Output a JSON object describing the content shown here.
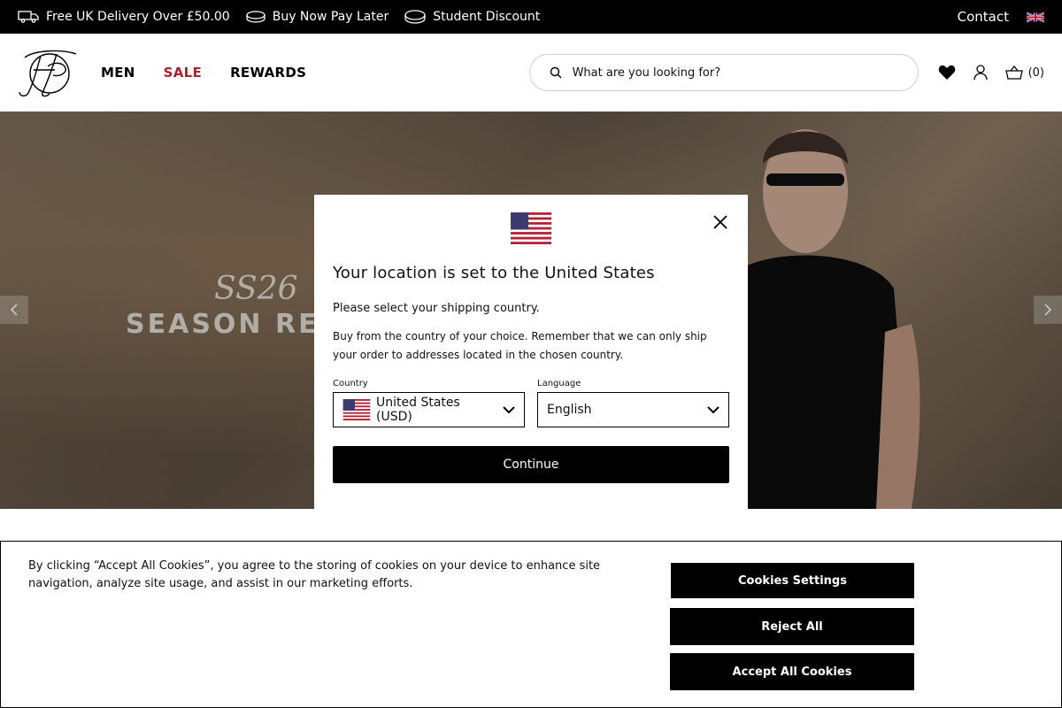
{
  "promo": {
    "items": [
      "Free UK Delivery Over £50.00",
      "Buy Now Pay Later",
      "Student Discount"
    ],
    "contact": "Contact"
  },
  "header": {
    "nav": [
      "MEN",
      "SALE",
      "REWARDS"
    ],
    "search_placeholder": "What are you looking for?",
    "basket_count": "(0)"
  },
  "hero": {
    "subtitle": "SS26",
    "title": "SEASON REF"
  },
  "modal": {
    "title": "Your location is set to the United States",
    "subtitle": "Please select your shipping country.",
    "body": "Buy from the country of your choice. Remember that we can only ship your order to addresses located in the chosen country.",
    "country_label": "Country",
    "country_value": "United States (USD)",
    "language_label": "Language",
    "language_value": "English",
    "continue_label": "Continue"
  },
  "cookie": {
    "text": "By clicking “Accept All Cookies”, you agree to the storing of cookies on your device to enhance site navigation, analyze site usage, and assist in our marketing efforts.",
    "settings_label": "Cookies Settings",
    "reject_label": "Reject All",
    "accept_label": "Accept All Cookies"
  },
  "colors": {
    "sale": "#b01f2e",
    "primary": "#000000"
  }
}
